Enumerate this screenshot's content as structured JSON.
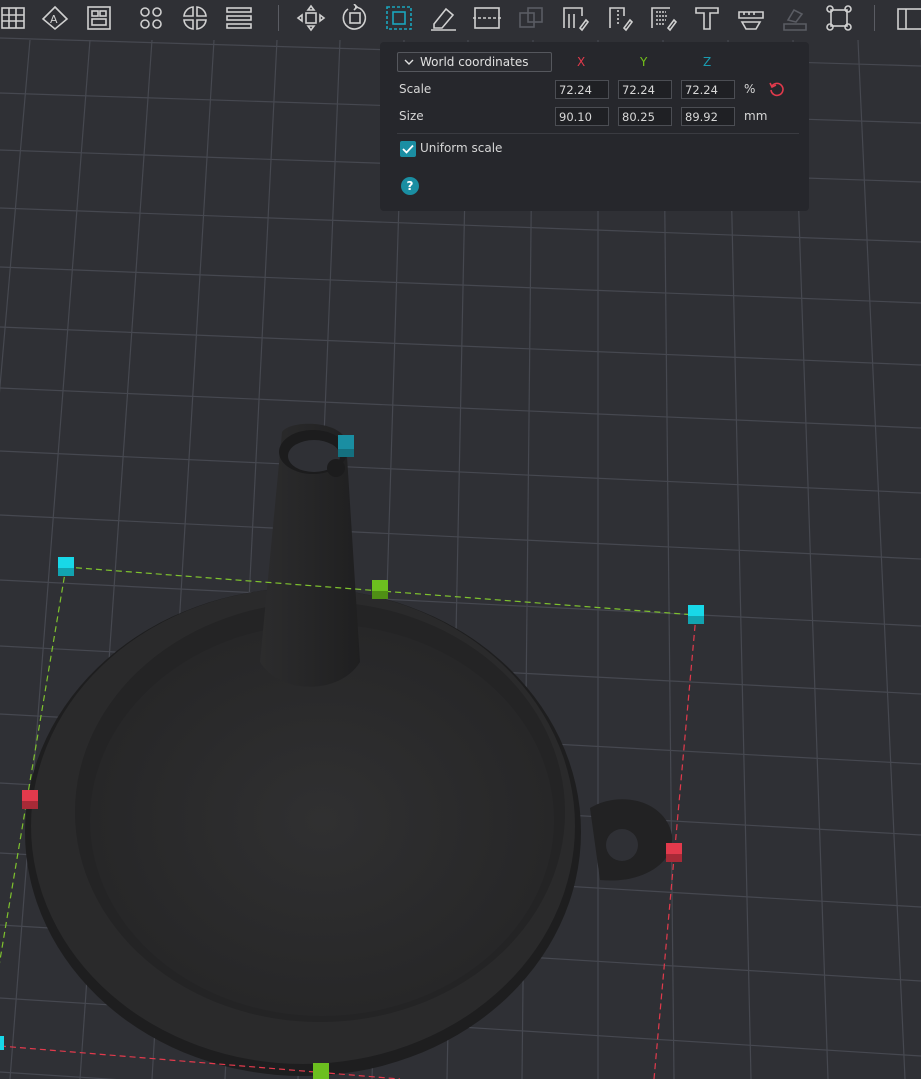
{
  "toolbar": {
    "tools": [
      "arrange-icon",
      "orient-to-face-icon",
      "plates-icon",
      "split-objects-icon",
      "split-parts-icon",
      "layers-icon",
      "move-icon",
      "rotate-icon",
      "scale-icon",
      "cut-icon",
      "place-on-face-icon",
      "mesh-boolean-icon",
      "support-painting-icon",
      "seam-painting-icon",
      "fuzzy-skin-icon",
      "text-icon",
      "measure-icon",
      "assembly-icon",
      "brim-ears-icon",
      "more-icon"
    ]
  },
  "scale_panel": {
    "coordinate_mode": "World coordinates",
    "axes": {
      "x": "X",
      "y": "Y",
      "z": "Z"
    },
    "scale": {
      "label": "Scale",
      "x": "72.24",
      "y": "72.24",
      "z": "72.24",
      "unit": "%"
    },
    "size": {
      "label": "Size",
      "x": "90.10",
      "y": "80.25",
      "z": "89.92",
      "unit": "mm"
    },
    "uniform_scale": {
      "label": "Uniform scale",
      "checked": true
    },
    "help_glyph": "?"
  },
  "colors": {
    "background": "#2f3035",
    "grid": "#474950",
    "panel": "#26272c",
    "axis_x": "#e23a4c",
    "axis_y": "#74c21a",
    "axis_z": "#1a9bb0",
    "accent": "#1b8ea3",
    "model": "#2a2a2b",
    "handle_cyan": "#18d8e8"
  }
}
